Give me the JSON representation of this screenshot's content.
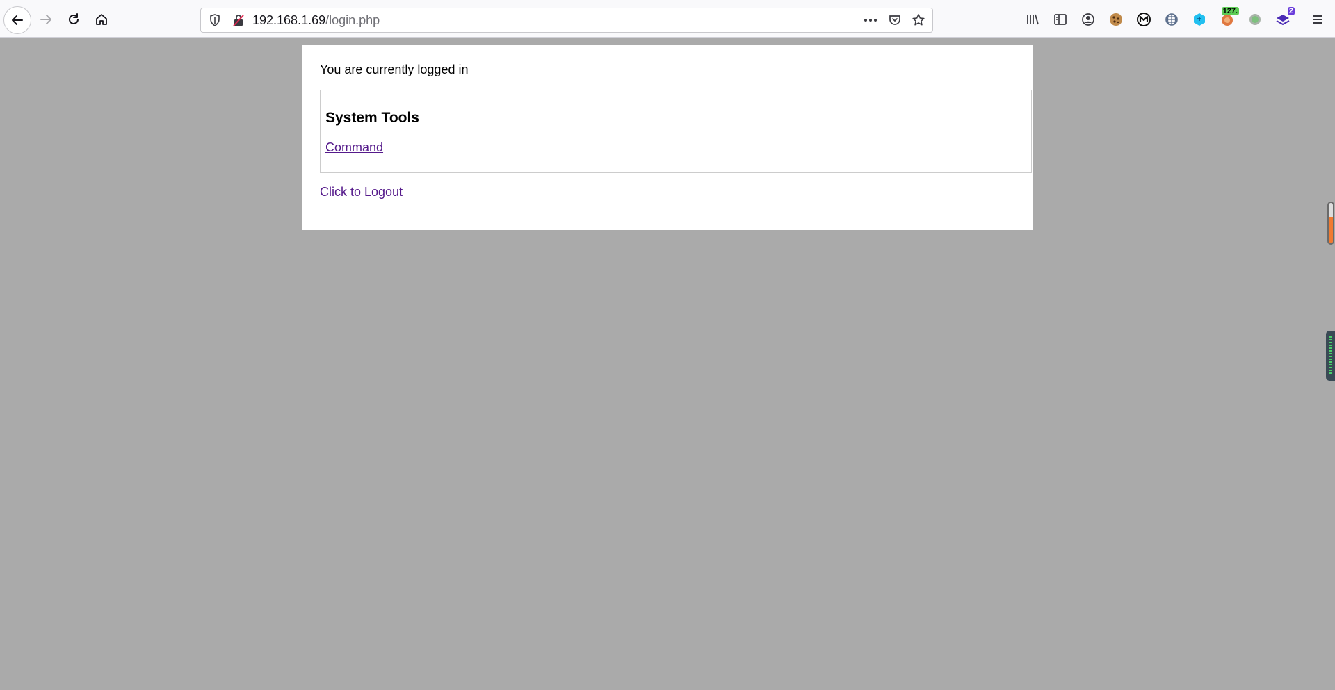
{
  "browser": {
    "url_host": "192.168.1.69",
    "url_path": "/login.php",
    "extensions": [
      {
        "name": "library-icon"
      },
      {
        "name": "sidebar-icon"
      },
      {
        "name": "account-icon"
      },
      {
        "name": "cookie-icon"
      },
      {
        "name": "metamask-icon"
      },
      {
        "name": "globe-grid-icon"
      },
      {
        "name": "blue-cube-icon"
      },
      {
        "name": "hackbar-icon",
        "badge": "127."
      },
      {
        "name": "grey-circle-icon"
      },
      {
        "name": "stack-icon",
        "badge": "2"
      }
    ],
    "badge_colors": {
      "green": "#5dcc55",
      "purple": "#6a3ddb"
    }
  },
  "page": {
    "status_text": "You are currently logged in",
    "tools_heading": "System Tools",
    "command_link": "Command",
    "logout_link": "Click to Logout",
    "background_color": "#aaaaaa",
    "link_color": "#551a8b"
  }
}
